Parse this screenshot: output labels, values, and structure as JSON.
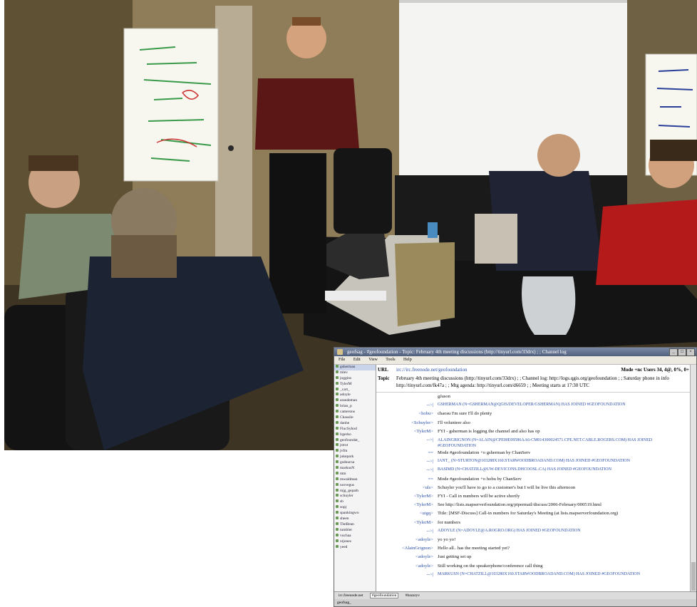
{
  "irc": {
    "title": "geofsag - #geofoundation - Topic: February 4th meeting discussions (http://tinyurl.com/33drx) ; ; Channel log",
    "menu": [
      "File",
      "Edit",
      "View",
      "Tools",
      "Help"
    ],
    "url_label": "URL",
    "url_value": "irc://irc.freenode.net/geofoundation",
    "mode_info": "Mode +nc  Users 34, 4@, 0%, 0+",
    "topic_label": "Topic",
    "topic_value": "February 4th meeting discussions (http://tinyurl.com/33drx) ; ; Channel log: http://logs.qgis.org/geofoundation ; ; Saturday phone in info http://tinyurl.com/fk47a ; ; Mtg agenda: http://tinyurl.com/d6659 ; ; Meeting starts at 17:30 UTC",
    "sidebar": [
      "gsherman",
      "mlev",
      "joggins",
      "TylerM",
      "_cart_",
      "adoyle",
      "arandeman",
      "brian_p",
      "camerons",
      "Chassile",
      "danhe",
      "FlucSyhod",
      "lrgerko",
      "geofoundat_",
      "jstrot",
      "jvfm",
      "jukepark",
      "gsdnuroa",
      "markusN",
      "mtn",
      "mwaldman",
      "norvegus",
      "mjg_gepath",
      "schuyler",
      "sb",
      "sopj",
      "spankingwo",
      "sheen",
      "TheBean",
      "tumbler",
      "vuchaa",
      "xtjones",
      "yeed"
    ],
    "log": [
      {
        "nick": "",
        "msg": "gJason",
        "type": "msg"
      },
      {
        "nick": "-->|",
        "msg": "GSHERMAN (N=GSHERMAN@QGIS/DEVELOPER/GSHERMAN) HAS JOINED #GEOFOUNDATION",
        "type": "join"
      },
      {
        "nick": "<hobu>",
        "msg": "chaosu  I'm sure I'll do plenty",
        "type": "msg"
      },
      {
        "nick": "<Schuyler>",
        "msg": "I'll volunteer also",
        "type": "msg"
      },
      {
        "nick": "<TylerM>",
        "msg": "FYI - gsherman is logging the channel and also has op",
        "type": "msg"
      },
      {
        "nick": "-->|",
        "msg": "ALAINGRIGNON (N=ALAIN@CPE00E09586AA6-CM014300024571.CPE.NET.CABLE.ROGERS.COM) HAS JOINED #GEOFOUNDATION",
        "type": "joinwrap"
      },
      {
        "nick": "==",
        "msg": "Mode #geofoundation +o gsherman  by ChanServ",
        "type": "msg"
      },
      {
        "nick": "-->|",
        "msg": "IANT_ (N=STURTON@103288X160.STARWOODBROADAND.COM) HAS JOINED #GEOFOUNDATION",
        "type": "join"
      },
      {
        "nick": "-->|",
        "msg": "BASIMD (N=CHATZILL@UW-DEVICONS.DHCOOSL.CA) HAS JOINED #GEOFOUNDATION",
        "type": "join"
      },
      {
        "nick": "==",
        "msg": "Mode #geofoundation +o hobu  by ChanServ",
        "type": "msg"
      },
      {
        "nick": "<uls>",
        "msg": "Schuyler  you'll have to go to a customer's  but I will be live this afternoon",
        "type": "msg"
      },
      {
        "nick": "<TylerM>",
        "msg": "FYI - Call in numbers will be active shortly",
        "type": "msg"
      },
      {
        "nick": "<TylerM>",
        "msg": "See http://lists.mapserverfoundation.org/pipermail/discuss/2006-February/000519.html",
        "type": "msg"
      },
      {
        "nick": "<uigq>",
        "msg": "Title: [MSF-Discuss] Call-in numbers for Saturday's Meeting (at lists.mapserverfoundation.org)",
        "type": "msg"
      },
      {
        "nick": "<TylerM>",
        "msg": "for numbers",
        "type": "msg"
      },
      {
        "nick": "-->|",
        "msg": "ADOYLE (N=ADOYLE@A.ROGRO.ORG) HAS JOINED #GEOFOUNDATION",
        "type": "join"
      },
      {
        "nick": "<adoyle>",
        "msg": "yo yo yo!",
        "type": "msg"
      },
      {
        "nick": "<AlainGrignon>",
        "msg": "Hello all.. has the meeting started yet?",
        "type": "msg"
      },
      {
        "nick": "<adoyle>",
        "msg": "Just getting set up",
        "type": "msg"
      },
      {
        "nick": "<adoyle>",
        "msg": "Still working on the speakerphone/conference call thing",
        "type": "msg"
      },
      {
        "nick": "-->|",
        "msg": "MARKUSN (N=CHATZILL@103280X160.STARWOODBROADAND.COM) HAS JOINED #GEOFOUNDATION",
        "type": "join"
      }
    ],
    "tabs": [
      "irc.freenode.net",
      "#geofoundation",
      "#bazaryv"
    ],
    "status": "geofsag_"
  }
}
